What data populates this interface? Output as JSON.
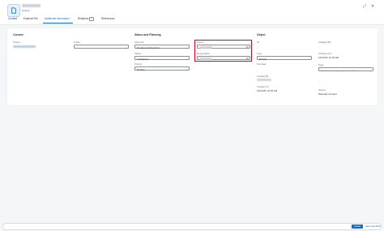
{
  "header": {
    "subtitle": "Default",
    "icons": [
      "fullscreen-icon",
      "close-icon"
    ]
  },
  "tabs": [
    {
      "label": "Content"
    },
    {
      "label": "External File"
    },
    {
      "label": "Additional Information",
      "active": true
    },
    {
      "label": "Relations",
      "badge": "1"
    },
    {
      "label": "References"
    }
  ],
  "content_section": {
    "title": "Context",
    "project_label": "Project:",
    "folder_label": "Folder:"
  },
  "status_section": {
    "title": "Status and Planning",
    "approval_label": "Approval:",
    "approval_value": "No Approval Required",
    "status_label": "Status:",
    "status_value": "In Progress",
    "priority_label": "Priority:",
    "priority_value": "Medium",
    "owner_label": "Owner:",
    "responsible_label": "Responsible:"
  },
  "object_section": {
    "title": "Object",
    "id_label": "ID:",
    "id_value": "-",
    "type_label": "Type:",
    "type_value": "Default",
    "template_label": "Template:",
    "template_value": "-",
    "created_by_label": "Created By:",
    "created_on_label": "Created On:",
    "created_on_value": "10/13/25, 10:35 AM",
    "changed_by_label": "Changed By:",
    "changed_by_value": "-",
    "changed_on_label": "Changed On:",
    "changed_on_value": "10/13/25, 10:35 AM",
    "tags_label": "Tags:",
    "tags_placeholder": "Enter text for tag search or creation",
    "tags_dash": "-",
    "source_label": "Source:",
    "source_value": "Manually Created"
  },
  "footer": {
    "create_label": "Create",
    "create_edit_label": "Save and Draft"
  },
  "colors": {
    "accent": "#0a6ed1",
    "highlight": "#e0001e"
  }
}
